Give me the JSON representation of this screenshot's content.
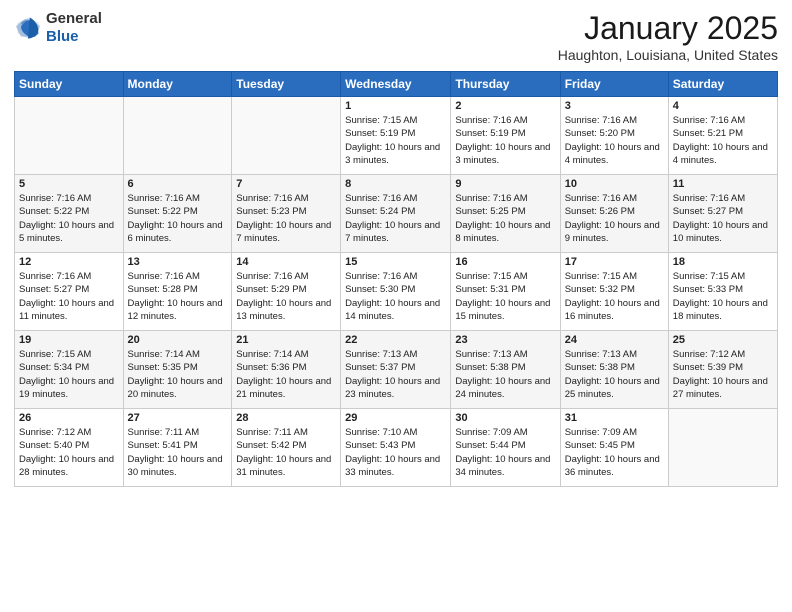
{
  "logo": {
    "general": "General",
    "blue": "Blue"
  },
  "header": {
    "month": "January 2025",
    "location": "Haughton, Louisiana, United States"
  },
  "weekdays": [
    "Sunday",
    "Monday",
    "Tuesday",
    "Wednesday",
    "Thursday",
    "Friday",
    "Saturday"
  ],
  "weeks": [
    [
      {
        "day": "",
        "sunrise": "",
        "sunset": "",
        "daylight": ""
      },
      {
        "day": "",
        "sunrise": "",
        "sunset": "",
        "daylight": ""
      },
      {
        "day": "",
        "sunrise": "",
        "sunset": "",
        "daylight": ""
      },
      {
        "day": "1",
        "sunrise": "Sunrise: 7:15 AM",
        "sunset": "Sunset: 5:19 PM",
        "daylight": "Daylight: 10 hours and 3 minutes."
      },
      {
        "day": "2",
        "sunrise": "Sunrise: 7:16 AM",
        "sunset": "Sunset: 5:19 PM",
        "daylight": "Daylight: 10 hours and 3 minutes."
      },
      {
        "day": "3",
        "sunrise": "Sunrise: 7:16 AM",
        "sunset": "Sunset: 5:20 PM",
        "daylight": "Daylight: 10 hours and 4 minutes."
      },
      {
        "day": "4",
        "sunrise": "Sunrise: 7:16 AM",
        "sunset": "Sunset: 5:21 PM",
        "daylight": "Daylight: 10 hours and 4 minutes."
      }
    ],
    [
      {
        "day": "5",
        "sunrise": "Sunrise: 7:16 AM",
        "sunset": "Sunset: 5:22 PM",
        "daylight": "Daylight: 10 hours and 5 minutes."
      },
      {
        "day": "6",
        "sunrise": "Sunrise: 7:16 AM",
        "sunset": "Sunset: 5:22 PM",
        "daylight": "Daylight: 10 hours and 6 minutes."
      },
      {
        "day": "7",
        "sunrise": "Sunrise: 7:16 AM",
        "sunset": "Sunset: 5:23 PM",
        "daylight": "Daylight: 10 hours and 7 minutes."
      },
      {
        "day": "8",
        "sunrise": "Sunrise: 7:16 AM",
        "sunset": "Sunset: 5:24 PM",
        "daylight": "Daylight: 10 hours and 7 minutes."
      },
      {
        "day": "9",
        "sunrise": "Sunrise: 7:16 AM",
        "sunset": "Sunset: 5:25 PM",
        "daylight": "Daylight: 10 hours and 8 minutes."
      },
      {
        "day": "10",
        "sunrise": "Sunrise: 7:16 AM",
        "sunset": "Sunset: 5:26 PM",
        "daylight": "Daylight: 10 hours and 9 minutes."
      },
      {
        "day": "11",
        "sunrise": "Sunrise: 7:16 AM",
        "sunset": "Sunset: 5:27 PM",
        "daylight": "Daylight: 10 hours and 10 minutes."
      }
    ],
    [
      {
        "day": "12",
        "sunrise": "Sunrise: 7:16 AM",
        "sunset": "Sunset: 5:27 PM",
        "daylight": "Daylight: 10 hours and 11 minutes."
      },
      {
        "day": "13",
        "sunrise": "Sunrise: 7:16 AM",
        "sunset": "Sunset: 5:28 PM",
        "daylight": "Daylight: 10 hours and 12 minutes."
      },
      {
        "day": "14",
        "sunrise": "Sunrise: 7:16 AM",
        "sunset": "Sunset: 5:29 PM",
        "daylight": "Daylight: 10 hours and 13 minutes."
      },
      {
        "day": "15",
        "sunrise": "Sunrise: 7:16 AM",
        "sunset": "Sunset: 5:30 PM",
        "daylight": "Daylight: 10 hours and 14 minutes."
      },
      {
        "day": "16",
        "sunrise": "Sunrise: 7:15 AM",
        "sunset": "Sunset: 5:31 PM",
        "daylight": "Daylight: 10 hours and 15 minutes."
      },
      {
        "day": "17",
        "sunrise": "Sunrise: 7:15 AM",
        "sunset": "Sunset: 5:32 PM",
        "daylight": "Daylight: 10 hours and 16 minutes."
      },
      {
        "day": "18",
        "sunrise": "Sunrise: 7:15 AM",
        "sunset": "Sunset: 5:33 PM",
        "daylight": "Daylight: 10 hours and 18 minutes."
      }
    ],
    [
      {
        "day": "19",
        "sunrise": "Sunrise: 7:15 AM",
        "sunset": "Sunset: 5:34 PM",
        "daylight": "Daylight: 10 hours and 19 minutes."
      },
      {
        "day": "20",
        "sunrise": "Sunrise: 7:14 AM",
        "sunset": "Sunset: 5:35 PM",
        "daylight": "Daylight: 10 hours and 20 minutes."
      },
      {
        "day": "21",
        "sunrise": "Sunrise: 7:14 AM",
        "sunset": "Sunset: 5:36 PM",
        "daylight": "Daylight: 10 hours and 21 minutes."
      },
      {
        "day": "22",
        "sunrise": "Sunrise: 7:13 AM",
        "sunset": "Sunset: 5:37 PM",
        "daylight": "Daylight: 10 hours and 23 minutes."
      },
      {
        "day": "23",
        "sunrise": "Sunrise: 7:13 AM",
        "sunset": "Sunset: 5:38 PM",
        "daylight": "Daylight: 10 hours and 24 minutes."
      },
      {
        "day": "24",
        "sunrise": "Sunrise: 7:13 AM",
        "sunset": "Sunset: 5:38 PM",
        "daylight": "Daylight: 10 hours and 25 minutes."
      },
      {
        "day": "25",
        "sunrise": "Sunrise: 7:12 AM",
        "sunset": "Sunset: 5:39 PM",
        "daylight": "Daylight: 10 hours and 27 minutes."
      }
    ],
    [
      {
        "day": "26",
        "sunrise": "Sunrise: 7:12 AM",
        "sunset": "Sunset: 5:40 PM",
        "daylight": "Daylight: 10 hours and 28 minutes."
      },
      {
        "day": "27",
        "sunrise": "Sunrise: 7:11 AM",
        "sunset": "Sunset: 5:41 PM",
        "daylight": "Daylight: 10 hours and 30 minutes."
      },
      {
        "day": "28",
        "sunrise": "Sunrise: 7:11 AM",
        "sunset": "Sunset: 5:42 PM",
        "daylight": "Daylight: 10 hours and 31 minutes."
      },
      {
        "day": "29",
        "sunrise": "Sunrise: 7:10 AM",
        "sunset": "Sunset: 5:43 PM",
        "daylight": "Daylight: 10 hours and 33 minutes."
      },
      {
        "day": "30",
        "sunrise": "Sunrise: 7:09 AM",
        "sunset": "Sunset: 5:44 PM",
        "daylight": "Daylight: 10 hours and 34 minutes."
      },
      {
        "day": "31",
        "sunrise": "Sunrise: 7:09 AM",
        "sunset": "Sunset: 5:45 PM",
        "daylight": "Daylight: 10 hours and 36 minutes."
      },
      {
        "day": "",
        "sunrise": "",
        "sunset": "",
        "daylight": ""
      }
    ]
  ]
}
